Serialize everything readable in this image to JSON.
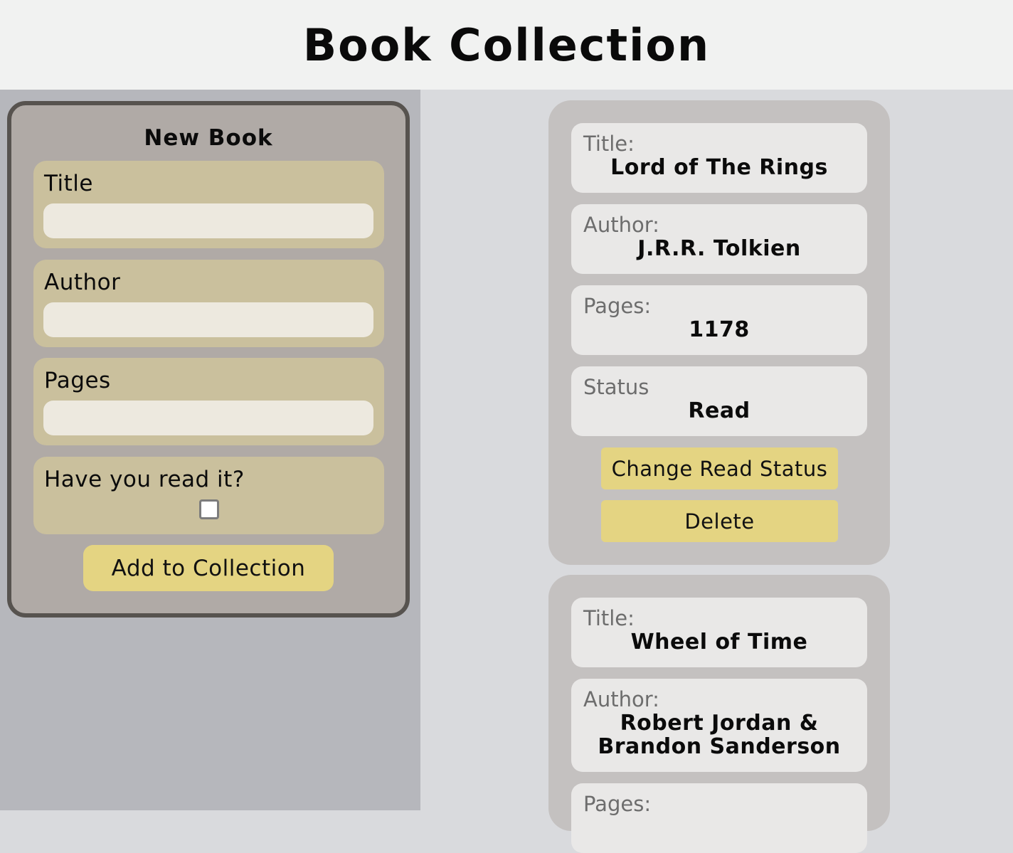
{
  "header": {
    "title": "Book Collection"
  },
  "form": {
    "title": "New Book",
    "title_label": "Title",
    "title_value": "",
    "author_label": "Author",
    "author_value": "",
    "pages_label": "Pages",
    "pages_value": "",
    "read_label": "Have you read it?",
    "read_checked": false,
    "submit_label": "Add to Collection"
  },
  "books": [
    {
      "title_key": "Title:",
      "title": "Lord of The Rings",
      "author_key": "Author:",
      "author": "J.R.R. Tolkien",
      "pages_key": "Pages:",
      "pages": "1178",
      "status_key": "Status",
      "status": "Read",
      "change_label": "Change Read Status",
      "delete_label": "Delete"
    },
    {
      "title_key": "Title:",
      "title": "Wheel of Time",
      "author_key": "Author:",
      "author_line1": "Robert Jordan &",
      "author_line2": "Brandon Sanderson",
      "pages_key": "Pages:"
    }
  ],
  "colors": {
    "accent_button": "#e4d482",
    "form_field": "#cac09d",
    "card": "#c4c1c0"
  }
}
